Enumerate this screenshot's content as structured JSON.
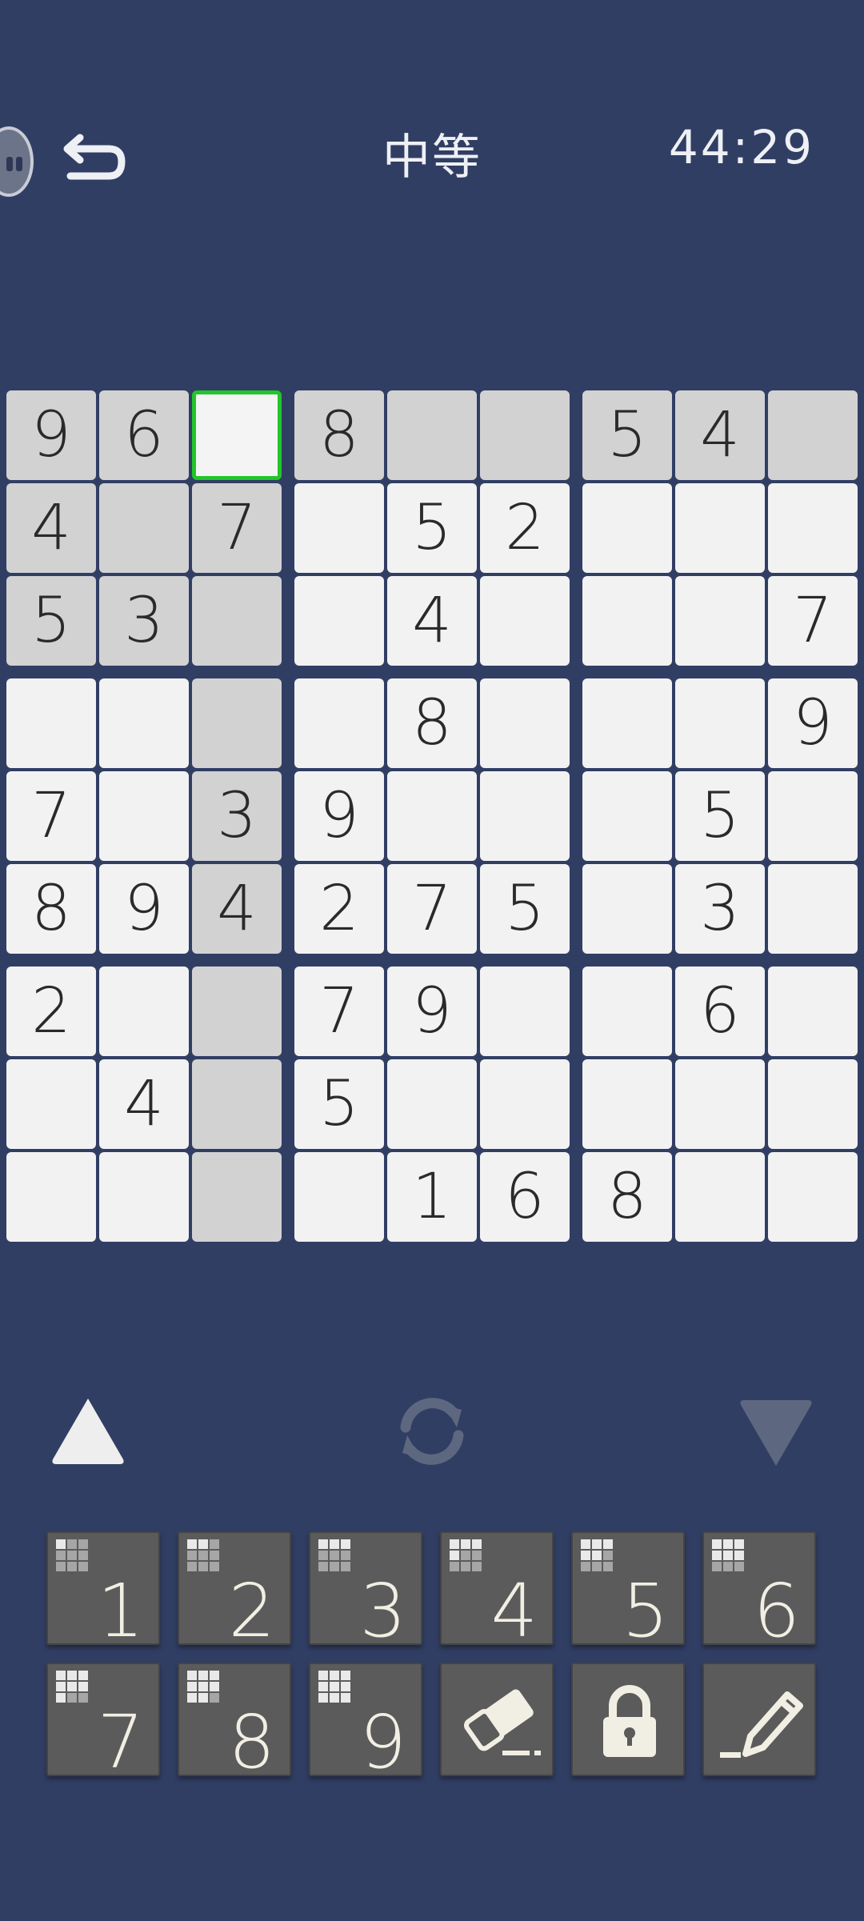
{
  "header": {
    "title": "中等",
    "timer": "44:29"
  },
  "icons": {
    "back": "back-arrow-icon",
    "avatar": "ghost-avatar-icon",
    "up": "triangle-up-icon",
    "refresh": "refresh-icon",
    "down": "triangle-down-icon",
    "erase": "eraser-icon",
    "lock": "lock-icon",
    "pencil": "pencil-icon"
  },
  "colors": {
    "background": "#313e64",
    "cell": "#f2f2f2",
    "cell_highlight": "#d2d2d2",
    "selected_border": "#22c52a",
    "key": "#5b5b5b"
  },
  "board": {
    "selected": [
      0,
      2
    ],
    "grid": [
      [
        "9",
        "6",
        "",
        "8",
        "",
        "",
        "5",
        "4",
        ""
      ],
      [
        "4",
        "",
        "7",
        "",
        "5",
        "2",
        "",
        "",
        ""
      ],
      [
        "5",
        "3",
        "",
        "",
        "4",
        "",
        "",
        "",
        "7"
      ],
      [
        "",
        "",
        "",
        "",
        "8",
        "",
        "",
        "",
        "9"
      ],
      [
        "7",
        "",
        "3",
        "9",
        "",
        "",
        "",
        "5",
        ""
      ],
      [
        "8",
        "9",
        "4",
        "2",
        "7",
        "5",
        "",
        "3",
        ""
      ],
      [
        "2",
        "",
        "",
        "7",
        "9",
        "",
        "",
        "6",
        ""
      ],
      [
        "",
        "4",
        "",
        "5",
        "",
        "",
        "",
        "",
        ""
      ],
      [
        "",
        "",
        "",
        "",
        "1",
        "6",
        "8",
        "",
        ""
      ]
    ]
  },
  "keypad": {
    "digits": [
      "1",
      "2",
      "3",
      "4",
      "5",
      "6",
      "7",
      "8",
      "9"
    ]
  }
}
